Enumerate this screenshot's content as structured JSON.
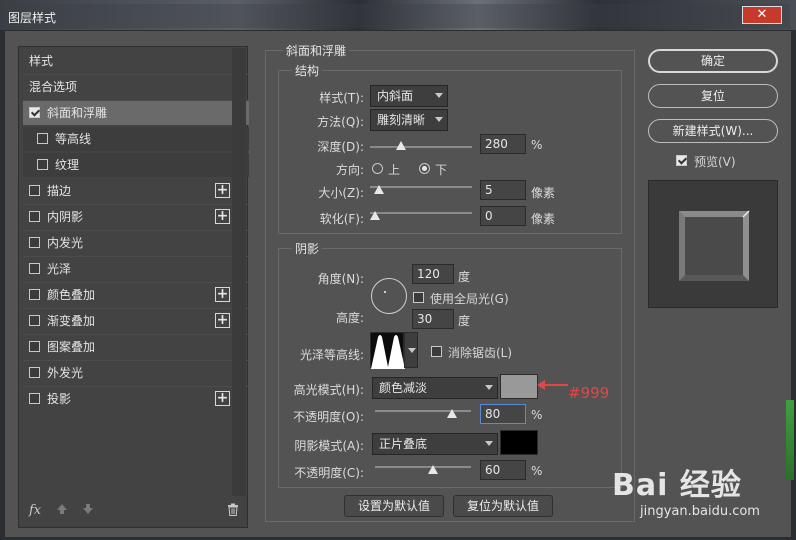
{
  "window": {
    "title": "图层样式",
    "close_label": "✕"
  },
  "styles_list": {
    "header": "样式",
    "blend": "混合选项",
    "items": [
      {
        "label": "斜面和浮雕",
        "checked": true
      },
      {
        "label": "等高线",
        "checked": false
      },
      {
        "label": "纹理",
        "checked": false
      },
      {
        "label": "描边",
        "checked": false
      },
      {
        "label": "内阴影",
        "checked": false
      },
      {
        "label": "内发光",
        "checked": false
      },
      {
        "label": "光泽",
        "checked": false
      },
      {
        "label": "颜色叠加",
        "checked": false
      },
      {
        "label": "渐变叠加",
        "checked": false
      },
      {
        "label": "图案叠加",
        "checked": false
      },
      {
        "label": "外发光",
        "checked": false
      },
      {
        "label": "投影",
        "checked": false
      }
    ],
    "fx_label": "fx"
  },
  "bevel": {
    "title": "斜面和浮雕",
    "structure_title": "结构",
    "style_label": "样式(T):",
    "style_value": "内斜面",
    "technique_label": "方法(Q):",
    "technique_value": "雕刻清晰",
    "depth_label": "深度(D):",
    "depth_value": "280",
    "depth_unit": "%",
    "direction_label": "方向:",
    "direction_up": "上",
    "direction_down": "下",
    "size_label": "大小(Z):",
    "size_value": "5",
    "size_unit": "像素",
    "soften_label": "软化(F):",
    "soften_value": "0",
    "soften_unit": "像素"
  },
  "shading": {
    "title": "阴影",
    "angle_label": "角度(N):",
    "angle_value": "120",
    "angle_unit": "度",
    "global_light_label": "使用全局光(G)",
    "altitude_label": "高度:",
    "altitude_value": "30",
    "altitude_unit": "度",
    "gloss_label": "光泽等高线:",
    "antialias_label": "消除锯齿(L)",
    "highlight_mode_label": "高光模式(H):",
    "highlight_mode_value": "颜色减淡",
    "highlight_color": "#999999",
    "highlight_opacity_label": "不透明度(O):",
    "highlight_opacity_value": "80",
    "shadow_mode_label": "阴影模式(A):",
    "shadow_mode_value": "正片叠底",
    "shadow_color": "#000000",
    "shadow_opacity_label": "不透明度(C):",
    "shadow_opacity_value": "60",
    "percent": "%"
  },
  "footer_buttons": {
    "set_default": "设置为默认值",
    "reset_default": "复位为默认值"
  },
  "right_buttons": {
    "ok": "确定",
    "reset": "复位",
    "new_style": "新建样式(W)...",
    "preview_label": "预览(V)"
  },
  "annotation": {
    "text": "#999",
    "color": "#e04848"
  },
  "watermark": {
    "brand": "Bai 经验",
    "url": "jingyan.baidu.com"
  }
}
